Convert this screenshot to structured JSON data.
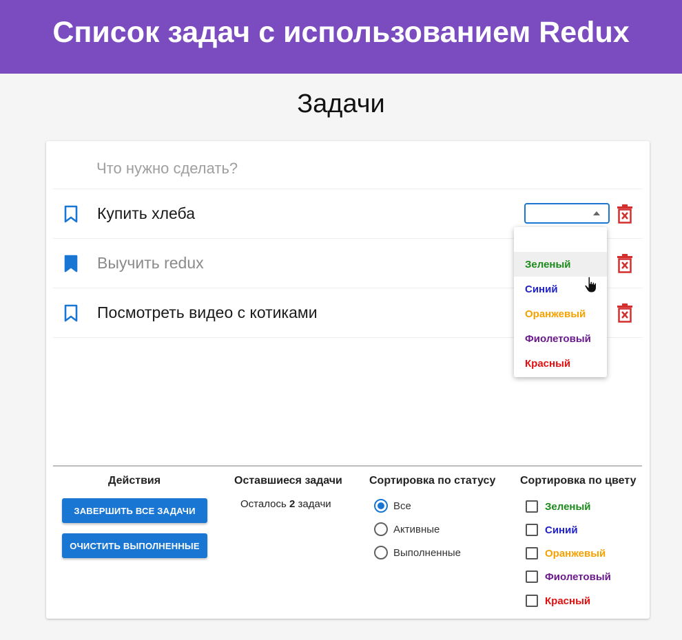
{
  "banner": {
    "title": "Список задач с использованием Redux"
  },
  "page": {
    "title": "Задачи"
  },
  "new_todo": {
    "placeholder": "Что нужно сделать?",
    "value": ""
  },
  "todos": [
    {
      "text": "Купить хлеба",
      "completed": false
    },
    {
      "text": "Выучить redux",
      "completed": true
    },
    {
      "text": "Посмотреть видео с котиками",
      "completed": false
    }
  ],
  "color_select": {
    "selected": ""
  },
  "color_options": [
    {
      "label": "Зеленый",
      "color": "#1b8a1b"
    },
    {
      "label": "Синий",
      "color": "#2121c8"
    },
    {
      "label": "Оранжевый",
      "color": "#f5a100"
    },
    {
      "label": "Фиолетовый",
      "color": "#6a1a8a"
    },
    {
      "label": "Красный",
      "color": "#e01010"
    }
  ],
  "footer": {
    "actions": {
      "heading": "Действия",
      "complete_all": "ЗАВЕРШИТЬ ВСЕ ЗАДАЧИ",
      "clear_completed": "ОЧИСТИТЬ ВЫПОЛНЕННЫЕ"
    },
    "remaining": {
      "heading": "Оставшиеся задачи",
      "prefix": "Осталось",
      "count": "2",
      "suffix": "задачи"
    },
    "status": {
      "heading": "Сортировка по статусу",
      "options": [
        {
          "label": "Все",
          "selected": true
        },
        {
          "label": "Активные",
          "selected": false
        },
        {
          "label": "Выполненные",
          "selected": false
        }
      ]
    },
    "colors": {
      "heading": "Сортировка по цвету",
      "options": [
        {
          "label": "Зеленый",
          "color": "#1b8a1b",
          "checked": false
        },
        {
          "label": "Синий",
          "color": "#2121c8",
          "checked": false
        },
        {
          "label": "Оранжевый",
          "color": "#f5a100",
          "checked": false
        },
        {
          "label": "Фиолетовый",
          "color": "#6a1a8a",
          "checked": false
        },
        {
          "label": "Красный",
          "color": "#e01010",
          "checked": false
        }
      ]
    }
  },
  "colors": {
    "banner": "#7a4cc0",
    "accent": "#1976d2",
    "delete": "#d32f2f"
  },
  "icons": {
    "todo_mark": "bookmark-icon",
    "todo_mark_done": "bookmark-filled-icon",
    "delete": "trash-x-icon",
    "cursor": "hand-pointer-icon"
  }
}
